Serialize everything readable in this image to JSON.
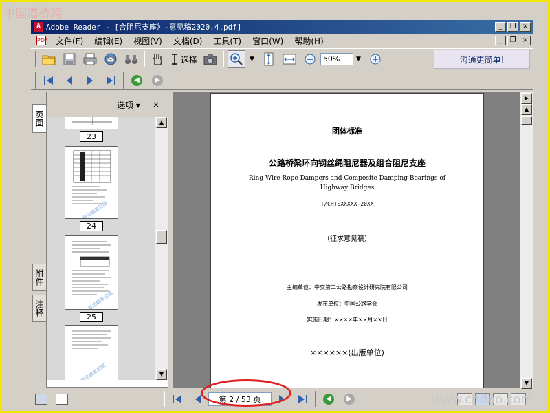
{
  "watermark": {
    "top": "中国道桥网",
    "bottom": "www.cndao.com"
  },
  "window": {
    "title": "Adobe Reader - [合阻尼支座》-意见稿2020.4.pdf]",
    "controls": {
      "minimize": "_",
      "restore": "❐",
      "close": "×"
    }
  },
  "menu": {
    "items": [
      "文件(F)",
      "编辑(E)",
      "视图(V)",
      "文档(D)",
      "工具(T)",
      "窗口(W)",
      "帮助(H)"
    ]
  },
  "toolbar": {
    "select_label": "选择",
    "zoom_value": "50%",
    "ad_text": "沟通更简单!"
  },
  "left_tabs": {
    "pages": "页面",
    "attachments": "附件",
    "comments": "注释"
  },
  "panel": {
    "options_label": "选项",
    "close_label": "×",
    "thumbnail_labels": [
      "23",
      "24",
      "25"
    ]
  },
  "document": {
    "line1": "团体标准",
    "title_cn": "公路桥梁环向钢丝绳阻尼器及组合阻尼支座",
    "title_en_1": "Ring Wire Rope Dampers and Composite Damping Bearings of",
    "title_en_2": "Highway Bridges",
    "code": "T/CHTSXXXXX-20XX",
    "draft": "（征求意见稿）",
    "editor": "主编单位：中交第二公路勘察设计研究院有限公司",
    "publisher": "发布单位：中国公路学会",
    "date": "实施日期：××××年××月××日",
    "footer": "××××××(出版单位)"
  },
  "status": {
    "page_indicator": "第 2 / 53 页"
  },
  "colors": {
    "title_bar": "#0a246a",
    "highlight_circle": "#e02020",
    "frame_border": "#f2e600"
  }
}
